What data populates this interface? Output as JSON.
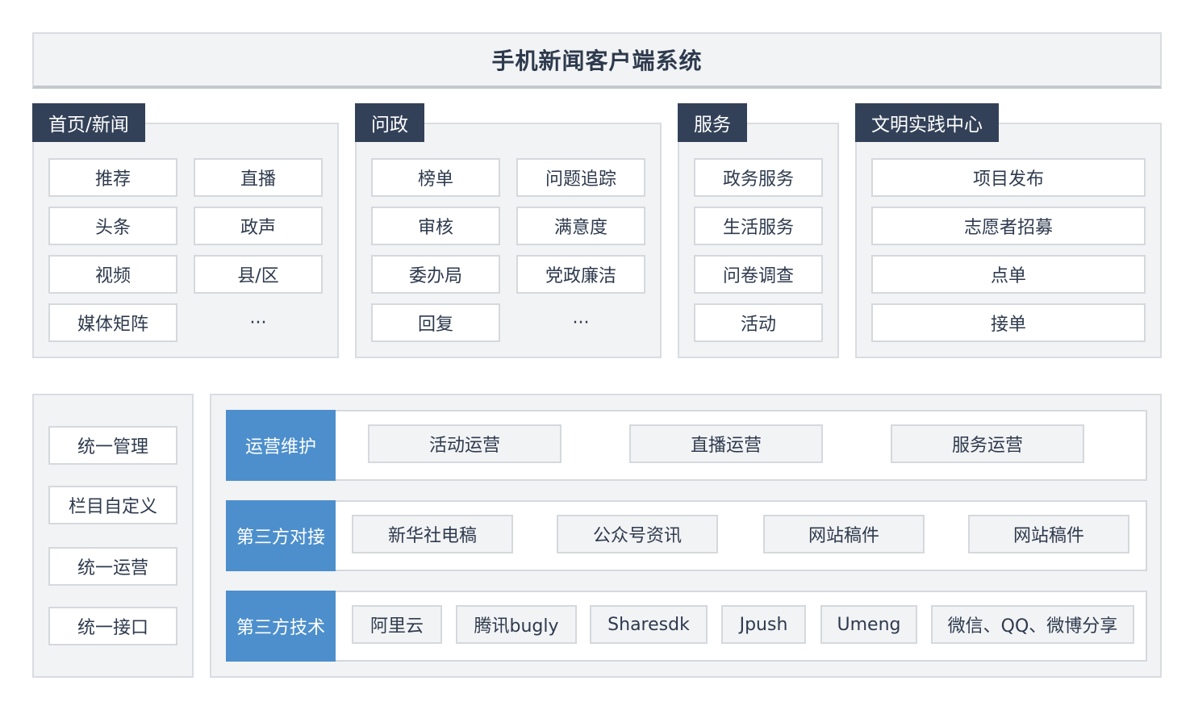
{
  "title": "手机新闻客户端系统",
  "modules": [
    {
      "tab": "首页/新闻",
      "items": [
        "推荐",
        "直播",
        "头条",
        "政声",
        "视频",
        "县/区",
        "媒体矩阵",
        "···"
      ]
    },
    {
      "tab": "问政",
      "items": [
        "榜单",
        "问题追踪",
        "审核",
        "满意度",
        "委办局",
        "党政廉洁",
        "回复",
        "···"
      ]
    },
    {
      "tab": "服务",
      "items": [
        "政务服务",
        "生活服务",
        "问卷调查",
        "活动"
      ]
    },
    {
      "tab": "文明实践中心",
      "items": [
        "项目发布",
        "志愿者招募",
        "点单",
        "接单"
      ]
    }
  ],
  "left_column": [
    "统一管理",
    "栏目自定义",
    "统一运营",
    "统一接口"
  ],
  "rows": [
    {
      "label": "运营维护",
      "items": [
        "活动运营",
        "直播运营",
        "服务运营"
      ]
    },
    {
      "label": "第三方对接",
      "items": [
        "新华社电稿",
        "公众号资讯",
        "网站稿件",
        "网站稿件"
      ]
    },
    {
      "label": "第三方技术",
      "items": [
        "阿里云",
        "腾讯bugly",
        "Sharesdk",
        "Jpush",
        "Umeng",
        "微信、QQ、微博分享"
      ]
    }
  ],
  "colors": {
    "tab_bg": "#334158",
    "accent_blue": "#4d8fcc",
    "panel_bg": "#f2f3f5"
  }
}
